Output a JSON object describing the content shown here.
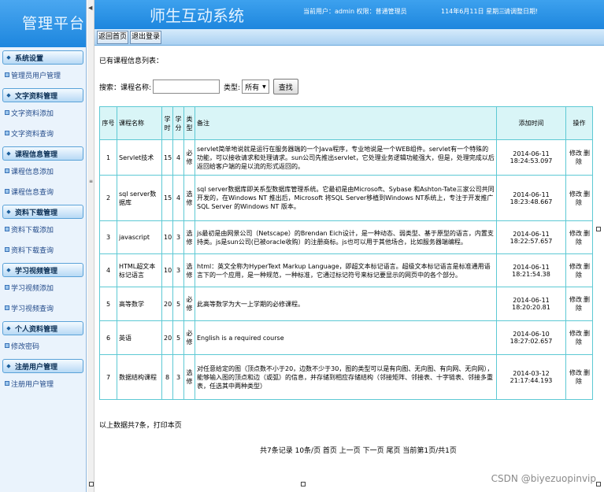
{
  "sidebar": {
    "logo": "管理平台",
    "groups": [
      {
        "title": "系统设置",
        "items": [
          "管理员用户管理"
        ]
      },
      {
        "title": "文字资料管理",
        "items": [
          "文字资料添加",
          "文字资料查询"
        ]
      },
      {
        "title": "课程信息管理",
        "items": [
          "课程信息添加",
          "课程信息查询"
        ]
      },
      {
        "title": "资料下载管理",
        "items": [
          "资料下载添加",
          "资料下载查询"
        ]
      },
      {
        "title": "学习视频管理",
        "items": [
          "学习视频添加",
          "学习视频查询"
        ]
      },
      {
        "title": "个人资料管理",
        "items": [
          "修改密码"
        ]
      },
      {
        "title": "注册用户管理",
        "items": [
          "注册用户管理"
        ]
      }
    ]
  },
  "header": {
    "system_title": "师生互动系统",
    "user_info": "当前用户：admin  权限：普通管理员",
    "date": "114年6月11日  星期三",
    "greeting": "请调整日期!",
    "nav": [
      "返回首页",
      "退出登录"
    ]
  },
  "main": {
    "list_title": "已有课程信息列表：",
    "search": {
      "label": "搜索：课程名称:",
      "value": "",
      "type_label": "类型:",
      "type_selected": "所有",
      "button": "查找"
    },
    "table": {
      "headers": [
        "序号",
        "课程名称",
        "学时",
        "学分",
        "类型",
        "备注",
        "添加时间",
        "操作"
      ],
      "rows": [
        {
          "no": "1",
          "name": "Servlet技术",
          "hours": "15",
          "credit": "4",
          "type": "必修",
          "note": "servlet简单地说就是运行在服务器端的一个Java程序，专业地说是一个WEB组件。servlet有一个特殊的功能，可以接收请求和处理请求。sun公司先推出servlet，它处理业务逻辑功能强大，但是，处理完成以后返回给客户端的是以流的形式返回的。",
          "date": "2014-06-11",
          "time": "18:24:53.097",
          "edit": "修改",
          "del": "删除"
        },
        {
          "no": "2",
          "name": "sql server数据库",
          "hours": "15",
          "credit": "4",
          "type": "选修",
          "note": "sql server数据库即关系型数据库管理系统。它最初是由Microsoft、Sybase 和Ashton-Tate三家公司共同开发的，在Windows NT 推出后，Microsoft 将SQL Server移植到Windows NT系统上，专注于开发推广SQL Server 的Windows NT 版本。",
          "date": "2014-06-11",
          "time": "18:23:48.667",
          "edit": "修改",
          "del": "删除"
        },
        {
          "no": "3",
          "name": "javascript",
          "hours": "10",
          "credit": "3",
          "type": "选修",
          "note": "js最初是由网景公司（Netscape）的Brendan Eich设计，是一种动态、弱类型、基于原型的语言，内置支持类。js是sun公司(已被oracle收购）的注册商标。js也可以用于其他场合，比如服务器端编程。",
          "date": "2014-06-11",
          "time": "18:22:57.657",
          "edit": "修改",
          "del": "删除"
        },
        {
          "no": "4",
          "name": "HTML超文本标记语言",
          "hours": "10",
          "credit": "3",
          "type": "选修",
          "note": "html：英文全称为HyperText Markup Language，即超文本标记语言。超级文本标记语言是标准通用语言下的一个应用，是一种规范，一种标准，它通过标记符号来标记要显示的网页中的各个部分。",
          "date": "2014-06-11",
          "time": "18:21:54.38",
          "edit": "修改",
          "del": "删除"
        },
        {
          "no": "5",
          "name": "高等数学",
          "hours": "20",
          "credit": "5",
          "type": "必修",
          "note": "此高等数学为大一上学期的必修课程。",
          "date": "2014-06-11",
          "time": "18:20:20.81",
          "edit": "修改",
          "del": "删除"
        },
        {
          "no": "6",
          "name": "英语",
          "hours": "20",
          "credit": "5",
          "type": "必修",
          "note": "English is a required course",
          "date": "2014-06-10",
          "time": "18:27:02.657",
          "edit": "修改",
          "del": "删除"
        },
        {
          "no": "7",
          "name": "数据结构课程",
          "hours": "8",
          "credit": "3",
          "type": "选修",
          "note": "对任意给定的图（顶点数不小于20，边数不少于30，图的类型可以是有向图、无向图、有向网、无向网），能够输入图的顶点和边（或弧）的信息，并存储到相应存储结构（邻接矩阵、邻接表、十字链表、邻接多重表，任选其中两种类型）",
          "date": "2014-03-12",
          "time": "21:17:44.193",
          "edit": "修改",
          "del": "删除"
        }
      ]
    },
    "summary": "以上数据共7条，打印本页",
    "pager": "共7条记录  10条/页  首页  上一页  下一页  尾页  当前第1页/共1页"
  },
  "watermark": "CSDN @biyezuopinvip"
}
